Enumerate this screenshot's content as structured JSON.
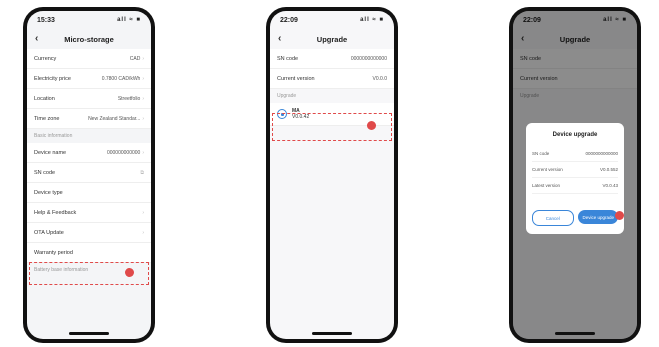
{
  "phone1": {
    "status": {
      "time": "15:33",
      "sys": "all ≈ ■"
    },
    "title": "Micro-storage",
    "rows_top": [
      {
        "label": "Currency",
        "value": "CAD"
      },
      {
        "label": "Electricity price",
        "value": "0.7800 CAD/kWh"
      },
      {
        "label": "Location",
        "value": "Streetfolio"
      },
      {
        "label": "Time zone",
        "value": "New Zealand Standar..."
      }
    ],
    "section_basic": "Basic information",
    "rows_basic": [
      {
        "label": "Device name",
        "value": "000000000000"
      },
      {
        "label": "SN code",
        "value": ""
      },
      {
        "label": "Device type",
        "value": ""
      },
      {
        "label": "Help & Feedback",
        "value": ""
      },
      {
        "label": "OTA Update",
        "value": ""
      },
      {
        "label": "Warranty period",
        "value": ""
      }
    ],
    "section_battery": "Battery base information"
  },
  "phone2": {
    "status": {
      "time": "22:09",
      "sys": "all ≈ ■"
    },
    "title": "Upgrade",
    "rows": [
      {
        "label": "SN code",
        "value": "0000000000000"
      },
      {
        "label": "Current version",
        "value": "V0.0.0"
      }
    ],
    "section": "Upgrade",
    "fw_item": {
      "name": "MA",
      "version": "V0.0.42"
    }
  },
  "phone3": {
    "status": {
      "time": "22:09",
      "sys": "all ≈ ■"
    },
    "title": "Upgrade",
    "rows": [
      {
        "label": "SN code",
        "value": ""
      },
      {
        "label": "Current version",
        "value": ""
      }
    ],
    "section": "Upgrade",
    "dialog": {
      "title": "Device upgrade",
      "rows": [
        {
          "label": "SN code",
          "value": "0000000000000"
        },
        {
          "label": "Current version",
          "value": "V0.0.552"
        },
        {
          "label": "Latest version",
          "value": "V0.0.43"
        }
      ],
      "cancel": "Cancel",
      "confirm": "Device upgrade"
    }
  }
}
